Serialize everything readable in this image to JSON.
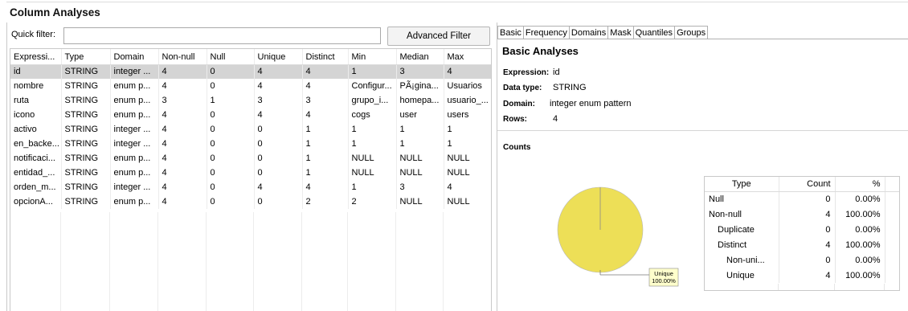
{
  "title": "Column Analyses",
  "quick_filter": {
    "label": "Quick filter:",
    "value": ""
  },
  "advanced_filter_label": "Advanced Filter",
  "grid": {
    "columns": [
      "Expressi...",
      "Type",
      "Domain",
      "Non-null",
      "Null",
      "Unique",
      "Distinct",
      "Min",
      "Median",
      "Max"
    ],
    "rows": [
      [
        "id",
        "STRING",
        "integer ...",
        "4",
        "0",
        "4",
        "4",
        "1",
        "3",
        "4"
      ],
      [
        "nombre",
        "STRING",
        "enum p...",
        "4",
        "0",
        "4",
        "4",
        "Configur...",
        "PÃ¡gina...",
        "Usuarios"
      ],
      [
        "ruta",
        "STRING",
        "enum p...",
        "3",
        "1",
        "3",
        "3",
        "grupo_i...",
        "homepa...",
        "usuario_..."
      ],
      [
        "icono",
        "STRING",
        "enum p...",
        "4",
        "0",
        "4",
        "4",
        "cogs",
        "user",
        "users"
      ],
      [
        "activo",
        "STRING",
        "integer ...",
        "4",
        "0",
        "0",
        "1",
        "1",
        "1",
        "1"
      ],
      [
        "en_backe...",
        "STRING",
        "integer ...",
        "4",
        "0",
        "0",
        "1",
        "1",
        "1",
        "1"
      ],
      [
        "notificaci...",
        "STRING",
        "enum p...",
        "4",
        "0",
        "0",
        "1",
        "NULL",
        "NULL",
        "NULL"
      ],
      [
        "entidad_...",
        "STRING",
        "enum p...",
        "4",
        "0",
        "0",
        "1",
        "NULL",
        "NULL",
        "NULL"
      ],
      [
        "orden_m...",
        "STRING",
        "integer ...",
        "4",
        "0",
        "4",
        "4",
        "1",
        "3",
        "4"
      ],
      [
        "opcionA...",
        "STRING",
        "enum p...",
        "4",
        "0",
        "0",
        "2",
        "2",
        "NULL",
        "NULL"
      ]
    ],
    "selected_row": 0
  },
  "tabs": [
    "Basic",
    "Frequency",
    "Domains",
    "Mask",
    "Quantiles",
    "Groups"
  ],
  "active_tab": "Basic",
  "basic": {
    "title": "Basic Analyses",
    "expression_label": "Expression:",
    "expression_value": "id",
    "data_type_label": "Data type:",
    "data_type_value": "STRING",
    "domain_label": "Domain:",
    "domain_value": "integer enum pattern",
    "rows_label": "Rows:",
    "rows_value": "4"
  },
  "counts": {
    "title": "Counts",
    "pie_label_name": "Unique",
    "pie_label_pct": "100.00%",
    "pie_color": "#eddf57",
    "headers": [
      "Type",
      "Count",
      "%"
    ],
    "rows": [
      {
        "type": "Null",
        "count": "0",
        "pct": "0.00%",
        "indent": 0
      },
      {
        "type": "Non-null",
        "count": "4",
        "pct": "100.00%",
        "indent": 0
      },
      {
        "type": "Duplicate",
        "count": "0",
        "pct": "0.00%",
        "indent": 1
      },
      {
        "type": "Distinct",
        "count": "4",
        "pct": "100.00%",
        "indent": 1
      },
      {
        "type": "Non-uni...",
        "count": "0",
        "pct": "0.00%",
        "indent": 2
      },
      {
        "type": "Unique",
        "count": "4",
        "pct": "100.00%",
        "indent": 2
      }
    ]
  }
}
